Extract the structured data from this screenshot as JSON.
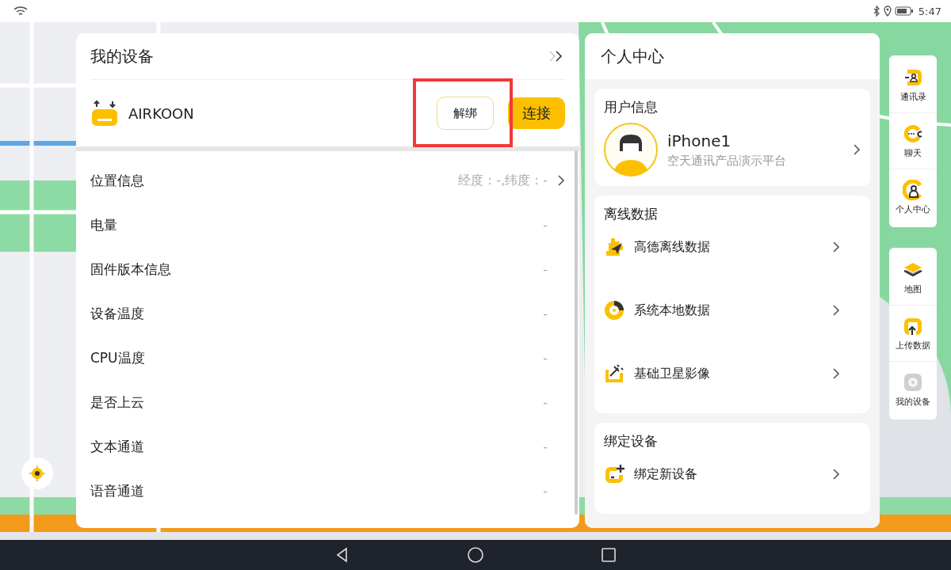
{
  "status_bar": {
    "time": "5:47"
  },
  "device_panel": {
    "title": "我的设备",
    "device": {
      "name": "AIRKOON",
      "unbind_button": "解绑",
      "connect_button": "连接"
    },
    "rows": [
      {
        "label": "位置信息",
        "value": "经度：-,纬度：-",
        "has_arrow": true
      },
      {
        "label": "电量",
        "value": "-",
        "has_arrow": false
      },
      {
        "label": "固件版本信息",
        "value": "-",
        "has_arrow": false
      },
      {
        "label": "设备温度",
        "value": "-",
        "has_arrow": false
      },
      {
        "label": "CPU温度",
        "value": "-",
        "has_arrow": false
      },
      {
        "label": "是否上云",
        "value": "-",
        "has_arrow": false
      },
      {
        "label": "文本通道",
        "value": "-",
        "has_arrow": false
      },
      {
        "label": "语音通道",
        "value": "-",
        "has_arrow": false
      }
    ]
  },
  "profile_panel": {
    "title": "个人中心",
    "user_card": {
      "heading": "用户信息",
      "name": "iPhone1",
      "subtitle": "空天通讯产品演示平台"
    },
    "offline_card": {
      "heading": "离线数据",
      "items": [
        {
          "label": "高德离线数据",
          "kind": "plane"
        },
        {
          "label": "系统本地数据",
          "kind": "disc"
        },
        {
          "label": "基础卫星影像",
          "kind": "satellite"
        }
      ]
    },
    "bind_card": {
      "heading": "绑定设备",
      "items": [
        {
          "label": "绑定新设备",
          "kind": "add"
        }
      ]
    }
  },
  "side_toolbar": {
    "groups": [
      [
        {
          "label": "通讯录",
          "kind": "contacts"
        },
        {
          "label": "聊天",
          "kind": "chat"
        },
        {
          "label": "个人中心",
          "kind": "person"
        }
      ],
      [
        {
          "label": "地图",
          "kind": "layers"
        },
        {
          "label": "上传数据",
          "kind": "upload"
        },
        {
          "label": "我的设备",
          "kind": "device"
        }
      ]
    ]
  }
}
